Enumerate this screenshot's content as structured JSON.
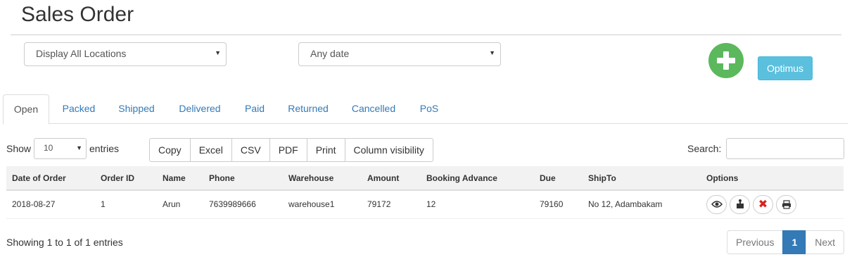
{
  "page": {
    "title": "Sales Order"
  },
  "filters": {
    "location": {
      "value": "Display All Locations"
    },
    "date": {
      "value": "Any date"
    }
  },
  "actions": {
    "optimus_label": "Optimus"
  },
  "tabs": [
    {
      "label": "Open",
      "active": true
    },
    {
      "label": "Packed"
    },
    {
      "label": "Shipped"
    },
    {
      "label": "Delivered"
    },
    {
      "label": "Paid"
    },
    {
      "label": "Returned"
    },
    {
      "label": "Cancelled"
    },
    {
      "label": "PoS"
    }
  ],
  "table_controls": {
    "show_label": "Show",
    "page_length": "10",
    "entries_label": "entries",
    "buttons": [
      "Copy",
      "Excel",
      "CSV",
      "PDF",
      "Print",
      "Column visibility"
    ],
    "search_label": "Search:",
    "search_value": ""
  },
  "table": {
    "columns": [
      "Date of Order",
      "Order ID",
      "Name",
      "Phone",
      "Warehouse",
      "Amount",
      "Booking Advance",
      "Due",
      "ShipTo",
      "Options"
    ],
    "rows": [
      [
        "2018-08-27",
        "1",
        "Arun",
        "7639989666",
        "warehouse1",
        "79172",
        "12",
        "79160",
        "No 12, Adambakam"
      ]
    ],
    "row_option_icons": [
      "view-eye-icon",
      "dispatch-package-icon",
      "cancel-x-icon",
      "print-icon"
    ]
  },
  "footer": {
    "info": "Showing 1 to 1 of 1 entries",
    "pagination": {
      "previous": "Previous",
      "current": "1",
      "next": "Next"
    }
  },
  "colors": {
    "add_button": "#5cb85c",
    "optimus_button": "#5bc0de",
    "link": "#337ab7",
    "cancel_icon": "#d9231d"
  }
}
